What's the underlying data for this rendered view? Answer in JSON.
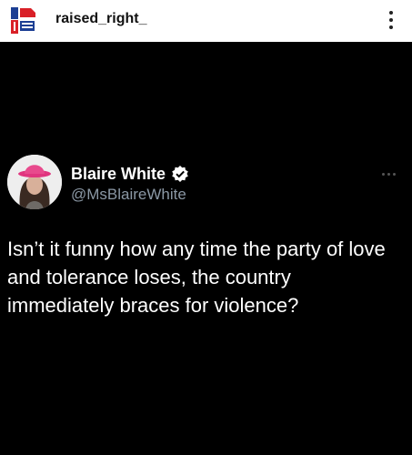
{
  "post": {
    "account_name": "raised_right_",
    "logo_icon": "raised-right-logo-icon",
    "menu_icon": "more-vertical-icon"
  },
  "tweet": {
    "display_name": "Blaire White",
    "handle": "@MsBlaireWhite",
    "verified_icon": "verified-badge-icon",
    "text": "Isn’t it funny how any time the party of love and tolerance loses, the country immediately braces for violence?",
    "menu_icon": "more-horizontal-icon"
  },
  "colors": {
    "tweet_background": "#000000",
    "handle_gray": "#8b98a5",
    "logo_red": "#d92027",
    "logo_blue": "#1c3f94"
  }
}
